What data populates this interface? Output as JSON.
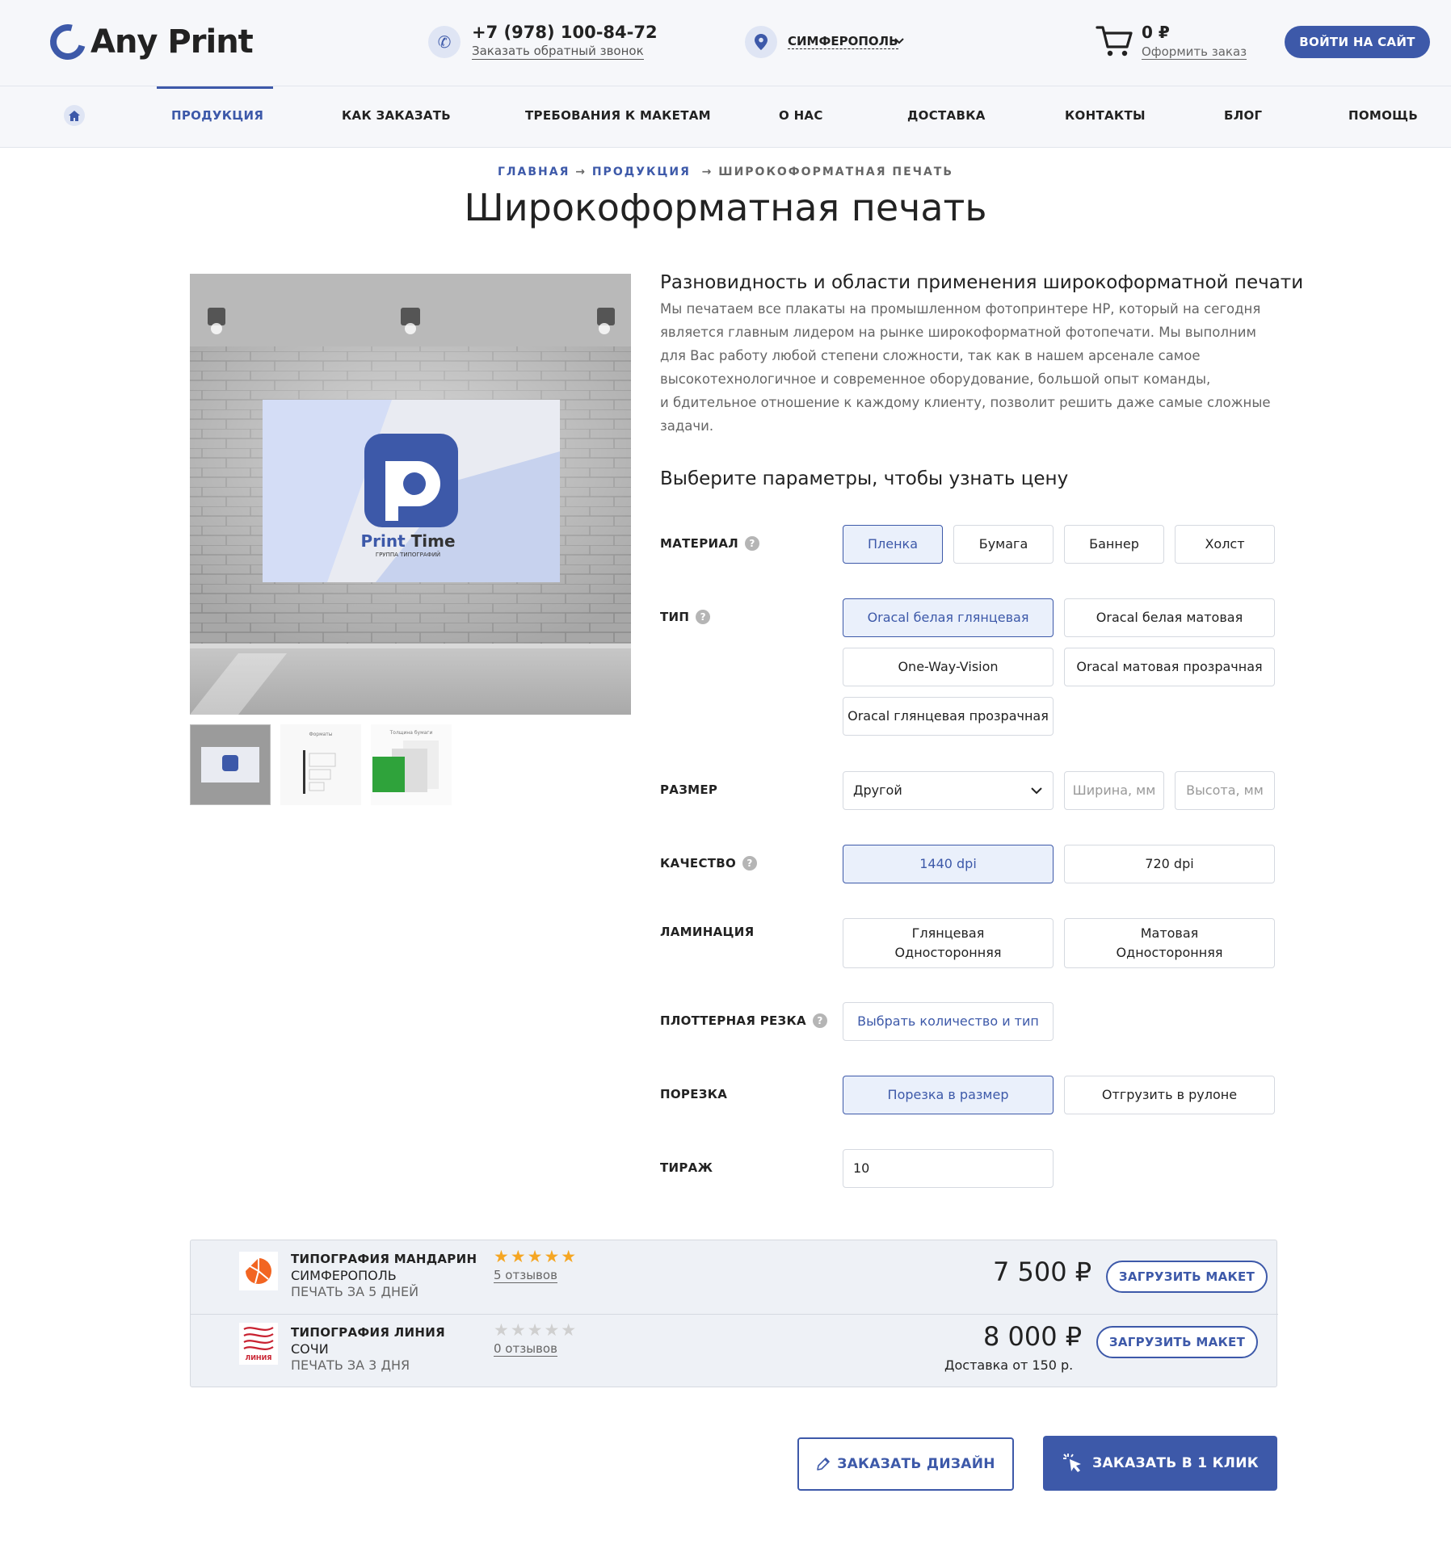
{
  "header": {
    "logo_text": "Any Print",
    "phone": "+7 (978) 100-84-72",
    "callback_link": "Заказать обратный звонок",
    "city": "СИМФЕРОПОЛЬ",
    "cart_sum": "0 ₽",
    "cart_link": "Оформить заказ",
    "login_button": "ВОЙТИ НА САЙТ"
  },
  "nav": {
    "items": [
      "ПРОДУКЦИЯ",
      "КАК ЗАКАЗАТЬ",
      "ТРЕБОВАНИЯ К МАКЕТАМ",
      "О НАС",
      "ДОСТАВКА",
      "КОНТАКТЫ",
      "БЛОГ",
      "ПОМОЩЬ"
    ],
    "active": "ПРОДУКЦИЯ"
  },
  "breadcrumb": {
    "home": "ГЛАВНАЯ",
    "products": "ПРОДУКЦИЯ",
    "current": "ШИРОКОФОРМАТНАЯ ПЕЧАТЬ",
    "sep": "→"
  },
  "page_title": "Широкоформатная печать",
  "product_image": {
    "brand_name_1": "Print",
    "brand_name_2": "Time",
    "brand_sub": "ГРУППА ТИПОГРАФИЙ",
    "thumb2_caption": "Форматы",
    "thumb3_caption": "Толщина бумаги"
  },
  "description": {
    "heading": "Разновидность и области применения широкоформатной печати",
    "lines": [
      "Мы печатаем все плакаты на промышленном фотопринтере HP, который на сегодня",
      "является главным лидером на рынке широкоформатной фотопечати. Мы выполним",
      "для Вас работу любой степени сложности, так как в нашем арсенале самое",
      "высокотехнологичное и современное оборудование, большой опыт команды,",
      "и бдительное отношение к каждому клиенту, позволит решить даже самые сложные",
      "задачи."
    ]
  },
  "params_heading": "Выберите параметры, чтобы узнать цену",
  "params": {
    "material": {
      "label": "МАТЕРИАЛ",
      "options": [
        "Пленка",
        "Бумага",
        "Баннер",
        "Холст"
      ],
      "selected": "Пленка"
    },
    "type": {
      "label": "ТИП",
      "options": [
        "Oracal белая глянцевая",
        "Oracal белая матовая",
        "One-Way-Vision",
        "Oracal матовая прозрачная",
        "Oracal глянцевая прозрачная"
      ],
      "selected": "Oracal белая глянцевая"
    },
    "size": {
      "label": "РАЗМЕР",
      "selected": "Другой",
      "width_placeholder": "Ширина, мм",
      "height_placeholder": "Высота, мм"
    },
    "quality": {
      "label": "КАЧЕСТВО",
      "options": [
        "1440 dpi",
        "720 dpi"
      ],
      "selected": "1440 dpi"
    },
    "lamination": {
      "label": "ЛАМИНАЦИЯ",
      "options": [
        [
          "Глянцевая",
          "Односторонняя"
        ],
        [
          "Матовая",
          "Односторонняя"
        ]
      ]
    },
    "plotter": {
      "label": "ПЛОТТЕРНАЯ РЕЗКА",
      "button": "Выбрать количество и тип"
    },
    "cutting": {
      "label": "ПОРЕЗКА",
      "options": [
        "Порезка в размер",
        "Отгрузить в рулоне"
      ],
      "selected": "Порезка в размер"
    },
    "quantity": {
      "label": "ТИРАЖ",
      "value": "10"
    }
  },
  "offers": [
    {
      "name": "ТИПОГРАФИЯ МАНДАРИН",
      "city": "СИМФЕРОПОЛЬ",
      "time": "ПЕЧАТЬ ЗА 5 ДНЕЙ",
      "rating": 5,
      "stars": "★★★★★",
      "reviews": "5 отзывов",
      "price": "7 500 ₽",
      "delivery": "",
      "button": "ЗАГРУЗИТЬ МАКЕТ"
    },
    {
      "name": "ТИПОГРАФИЯ ЛИНИЯ",
      "city": "СОЧИ",
      "time": "ПЕЧАТЬ ЗА 3 ДНЯ",
      "rating": 0,
      "stars": "★★★★★",
      "reviews": "0 отзывов",
      "price": "8 000 ₽",
      "delivery": "Доставка от 150 р.",
      "button": "ЗАГРУЗИТЬ МАКЕТ",
      "logo_text": "ЛИНИЯ"
    }
  ],
  "buttons": {
    "design": "ЗАКАЗАТЬ ДИЗАЙН",
    "one_click": "ЗАКАЗАТЬ В 1 КЛИК"
  },
  "colors": {
    "accent": "#3d59a9",
    "star_active": "#f5a623",
    "star_inactive": "#cfcfcf",
    "selected_bg": "#eaf0fb"
  }
}
